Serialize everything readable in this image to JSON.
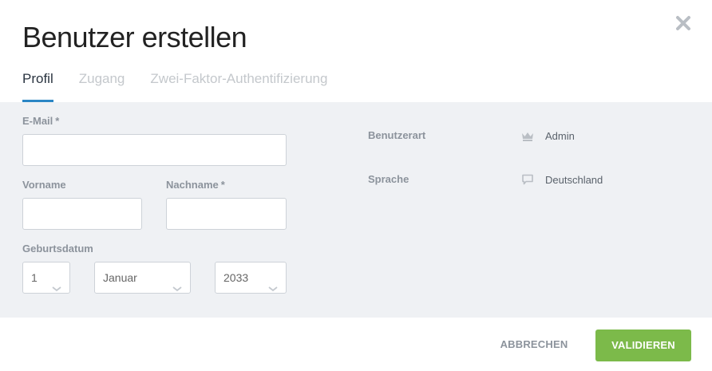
{
  "dialog": {
    "title": "Benutzer erstellen"
  },
  "tabs": [
    {
      "label": "Profil",
      "active": true
    },
    {
      "label": "Zugang",
      "active": false
    },
    {
      "label": "Zwei-Faktor-Authentifizierung",
      "active": false
    }
  ],
  "form": {
    "email": {
      "label": "E-Mail",
      "required_mark": "*",
      "value": ""
    },
    "firstname": {
      "label": "Vorname",
      "value": ""
    },
    "lastname": {
      "label": "Nachname",
      "required_mark": "*",
      "value": ""
    },
    "birthdate": {
      "label": "Geburtsdatum",
      "day": "1",
      "month": "Januar",
      "year": "2033"
    }
  },
  "info": {
    "user_type": {
      "label": "Benutzerart",
      "value": "Admin",
      "icon": "crown-icon"
    },
    "language": {
      "label": "Sprache",
      "value": "Deutschland",
      "icon": "speech-bubble-icon"
    }
  },
  "actions": {
    "cancel_label": "ABBRECHEN",
    "validate_label": "VALIDIEREN"
  },
  "colors": {
    "accent_tab": "#2b86c5",
    "primary_button": "#7cba4a",
    "form_background": "#eff1f4"
  }
}
